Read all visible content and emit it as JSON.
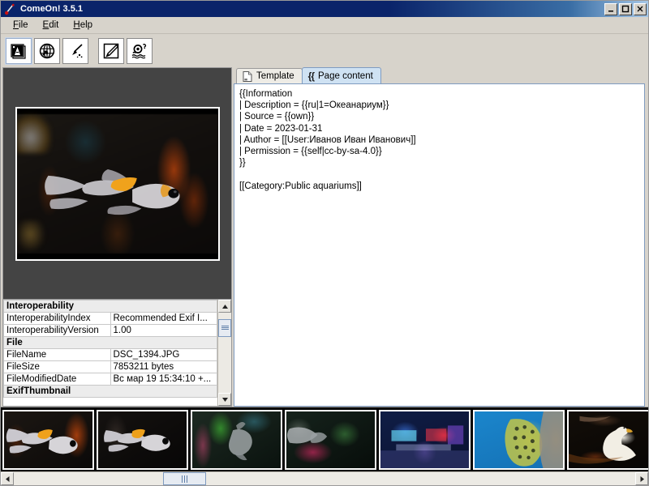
{
  "window": {
    "title": "ComeOn! 3.5.1",
    "icon": "app-icon",
    "buttons": {
      "minimize": "_",
      "maximize": "▢",
      "close": "✕"
    }
  },
  "menubar": {
    "items": [
      {
        "label": "File",
        "mnemonic": "F"
      },
      {
        "label": "Edit",
        "mnemonic": "E"
      },
      {
        "label": "Help",
        "mnemonic": "H"
      }
    ]
  },
  "toolbar": {
    "buttons": [
      {
        "name": "images-icon",
        "label": "Images",
        "selected": true
      },
      {
        "name": "globe-upload-icon",
        "label": "Upload to web",
        "selected": false
      },
      {
        "name": "wand-icon",
        "label": "Magic wand",
        "selected": false
      },
      {
        "name": "edit-pencil-icon",
        "label": "Edit",
        "selected": false
      },
      {
        "name": "help-person-icon",
        "label": "About",
        "selected": false
      }
    ]
  },
  "tabs": [
    {
      "label": "Template",
      "icon": "document-icon",
      "active": false
    },
    {
      "label": "Page content",
      "icon": "braces-icon",
      "active": true
    }
  ],
  "page_content": "{{Information\n| Description = {{ru|1=Океанариум}}\n| Source = {{own}}\n| Date = 2023-01-31\n| Author = [[User:Иванов Иван Иванович]]\n| Permission = {{self|cc-by-sa-4.0}}\n}}\n\n[[Category:Public aquariums]]",
  "metadata": {
    "rows": [
      {
        "type": "section",
        "key": "Interoperability"
      },
      {
        "type": "row",
        "key": "InteroperabilityIndex",
        "value": "Recommended Exif I..."
      },
      {
        "type": "row",
        "key": "InteroperabilityVersion",
        "value": "1.00"
      },
      {
        "type": "section",
        "key": "File"
      },
      {
        "type": "row",
        "key": "FileName",
        "value": "DSC_1394.JPG"
      },
      {
        "type": "row",
        "key": "FileSize",
        "value": "7853211 bytes"
      },
      {
        "type": "row",
        "key": "FileModifiedDate",
        "value": "Вс мар 19 15:34:10 +..."
      },
      {
        "type": "section",
        "key": "ExifThumbnail"
      }
    ]
  },
  "preview": {
    "name": "selected-image-preview",
    "alt": "Fancy goldfish in dark aquarium"
  },
  "thumbnails": [
    {
      "name": "thumbnail-1",
      "alt": "Goldfish swimming left",
      "cls": "t1",
      "selected": true
    },
    {
      "name": "thumbnail-2",
      "alt": "Goldfish facing right",
      "cls": "t2",
      "selected": false
    },
    {
      "name": "thumbnail-3",
      "alt": "Fish near green plants",
      "cls": "t3",
      "selected": false
    },
    {
      "name": "thumbnail-4",
      "alt": "Fish above pink coral",
      "cls": "t4",
      "selected": false
    },
    {
      "name": "thumbnail-5",
      "alt": "Aquarium hall interior",
      "cls": "t5",
      "selected": false
    },
    {
      "name": "thumbnail-6",
      "alt": "Moray eel on blue background",
      "cls": "t6",
      "selected": false
    },
    {
      "name": "thumbnail-7",
      "alt": "White swan on dark water",
      "cls": "t7",
      "selected": false
    }
  ],
  "scrollbars": {
    "metadata_vertical": {
      "thumb_top_pct": 8,
      "thumb_height_pct": 22
    },
    "thumbnail_horizontal": {
      "thumb_left_pct": 24,
      "thumb_width_pct": 7
    }
  },
  "colors": {
    "titlebar": "#0a246a",
    "window_bg": "#d7d3cb",
    "active_tab": "#cfe2f3",
    "border": "#9a9a9a",
    "text_bg": "#ffffff"
  }
}
